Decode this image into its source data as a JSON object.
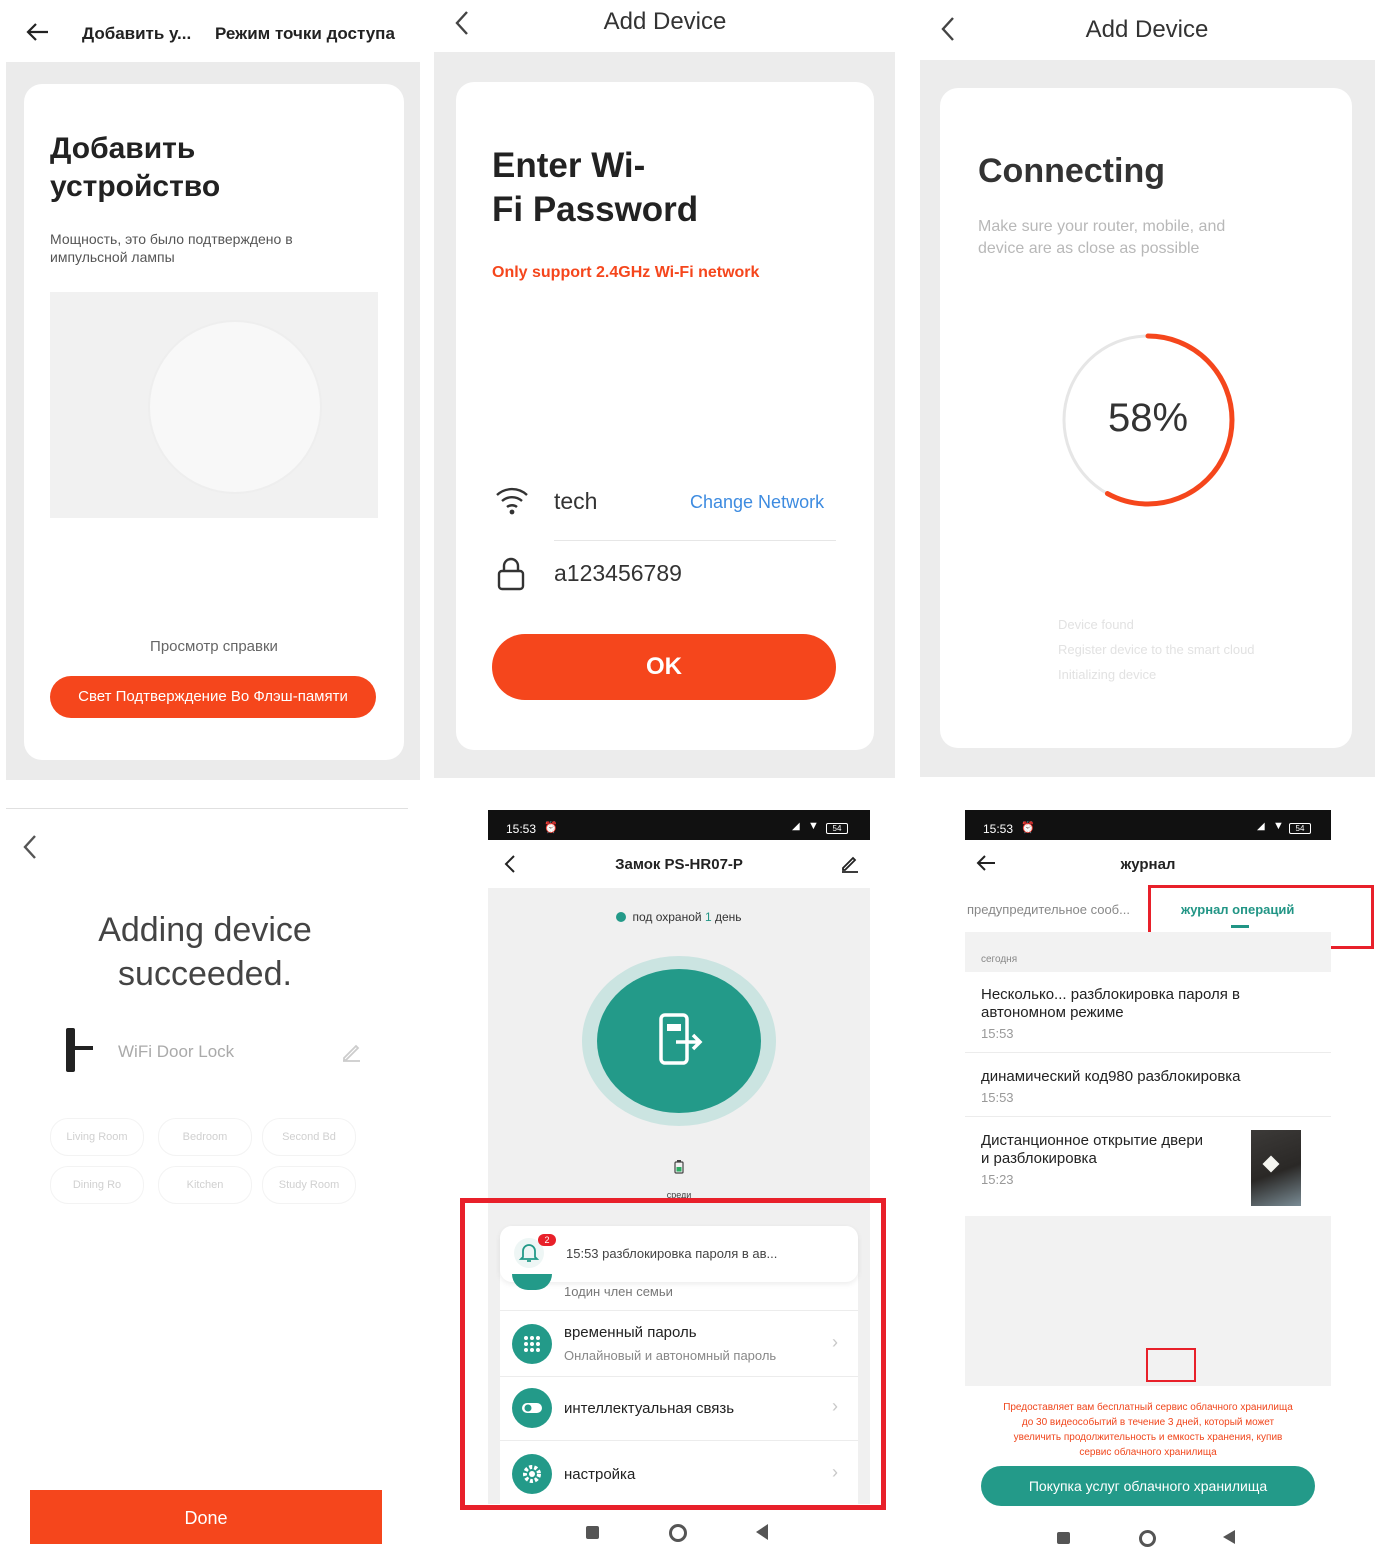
{
  "p1": {
    "header_left": "Добавить у...",
    "header_right": "Режим точки доступа",
    "title_line1": "Добавить",
    "title_line2": "устройство",
    "description": "Мощность, это было подтверждено в импульсной лампы",
    "help_link": "Просмотр справки",
    "confirm_button": "Свет Подтверждение Во Флэш-памяти"
  },
  "p2": {
    "header_title": "Add Device",
    "title_line1": "Enter Wi-",
    "title_line2": "Fi Password",
    "warning": "Only support 2.4GHz Wi-Fi network",
    "wifi_ssid": "tech",
    "change_network": "Change Network",
    "password": "a123456789",
    "ok_button": "OK"
  },
  "p3": {
    "header_title": "Add Device",
    "title": "Connecting",
    "description_line1": "Make sure your router, mobile, and",
    "description_line2": "device are as close as possible",
    "progress_label": "58%",
    "progress_value": 0.58,
    "steps": [
      "Device found",
      "Register device to the smart cloud",
      "Initializing device"
    ]
  },
  "p4": {
    "title_line1": "Adding device",
    "title_line2": "succeeded.",
    "device_name": "WiFi Door Lock",
    "room_chips": [
      "Living Room",
      "Bedroom",
      "Second Bd",
      "Dining Ro",
      "Kitchen",
      "Study Room"
    ],
    "done_button": "Done"
  },
  "p5": {
    "status_time": "15:53",
    "battery_level": "54",
    "header_title": "Замок PS-HR07-P",
    "guard_prefix": "под охраной",
    "guard_days": "1",
    "guard_suffix": "день",
    "battery_caption": "среди",
    "notif_badge": "2",
    "notif_text": "15:53 разблокировка пароля в ав...",
    "member_text": "1один член семьи",
    "menu": [
      {
        "title": "временный пароль",
        "subtitle": "Онлайновый и автономный пароль"
      },
      {
        "title": "интеллектуальная связь",
        "subtitle": ""
      },
      {
        "title": "настройка",
        "subtitle": ""
      }
    ]
  },
  "p6": {
    "status_time": "15:53",
    "battery_level": "54",
    "header_title": "журнал",
    "tab_warnings": "предупредительное сооб...",
    "tab_operations": "журнал операций",
    "section_today": "сегодня",
    "log": [
      {
        "line1": "Несколько... разблокировка пароля в",
        "line2": "автономном режиме",
        "time": "15:53"
      },
      {
        "line1": "динамический код980 разблокировка",
        "line2": "",
        "time": "15:53"
      },
      {
        "line1": "Дистанционное открытие двери",
        "line2": "и разблокировка",
        "time": "15:23"
      }
    ],
    "cloud_notice_line1": "Предоставляет вам бесплатный сервис облачного хранилища",
    "cloud_notice_line2": "до 30 видеособытий в течение 3 дней, который может",
    "cloud_notice_line3": "увеличить продолжительность и емкость хранения, купив",
    "cloud_notice_line4": "сервис облачного хранилища",
    "cloud_button": "Покупка услуг облачного хранилища"
  },
  "colors": {
    "accent_orange": "#f5461c",
    "accent_teal": "#239a89",
    "link_blue": "#3d8be0",
    "highlight_red": "#e8202a"
  }
}
